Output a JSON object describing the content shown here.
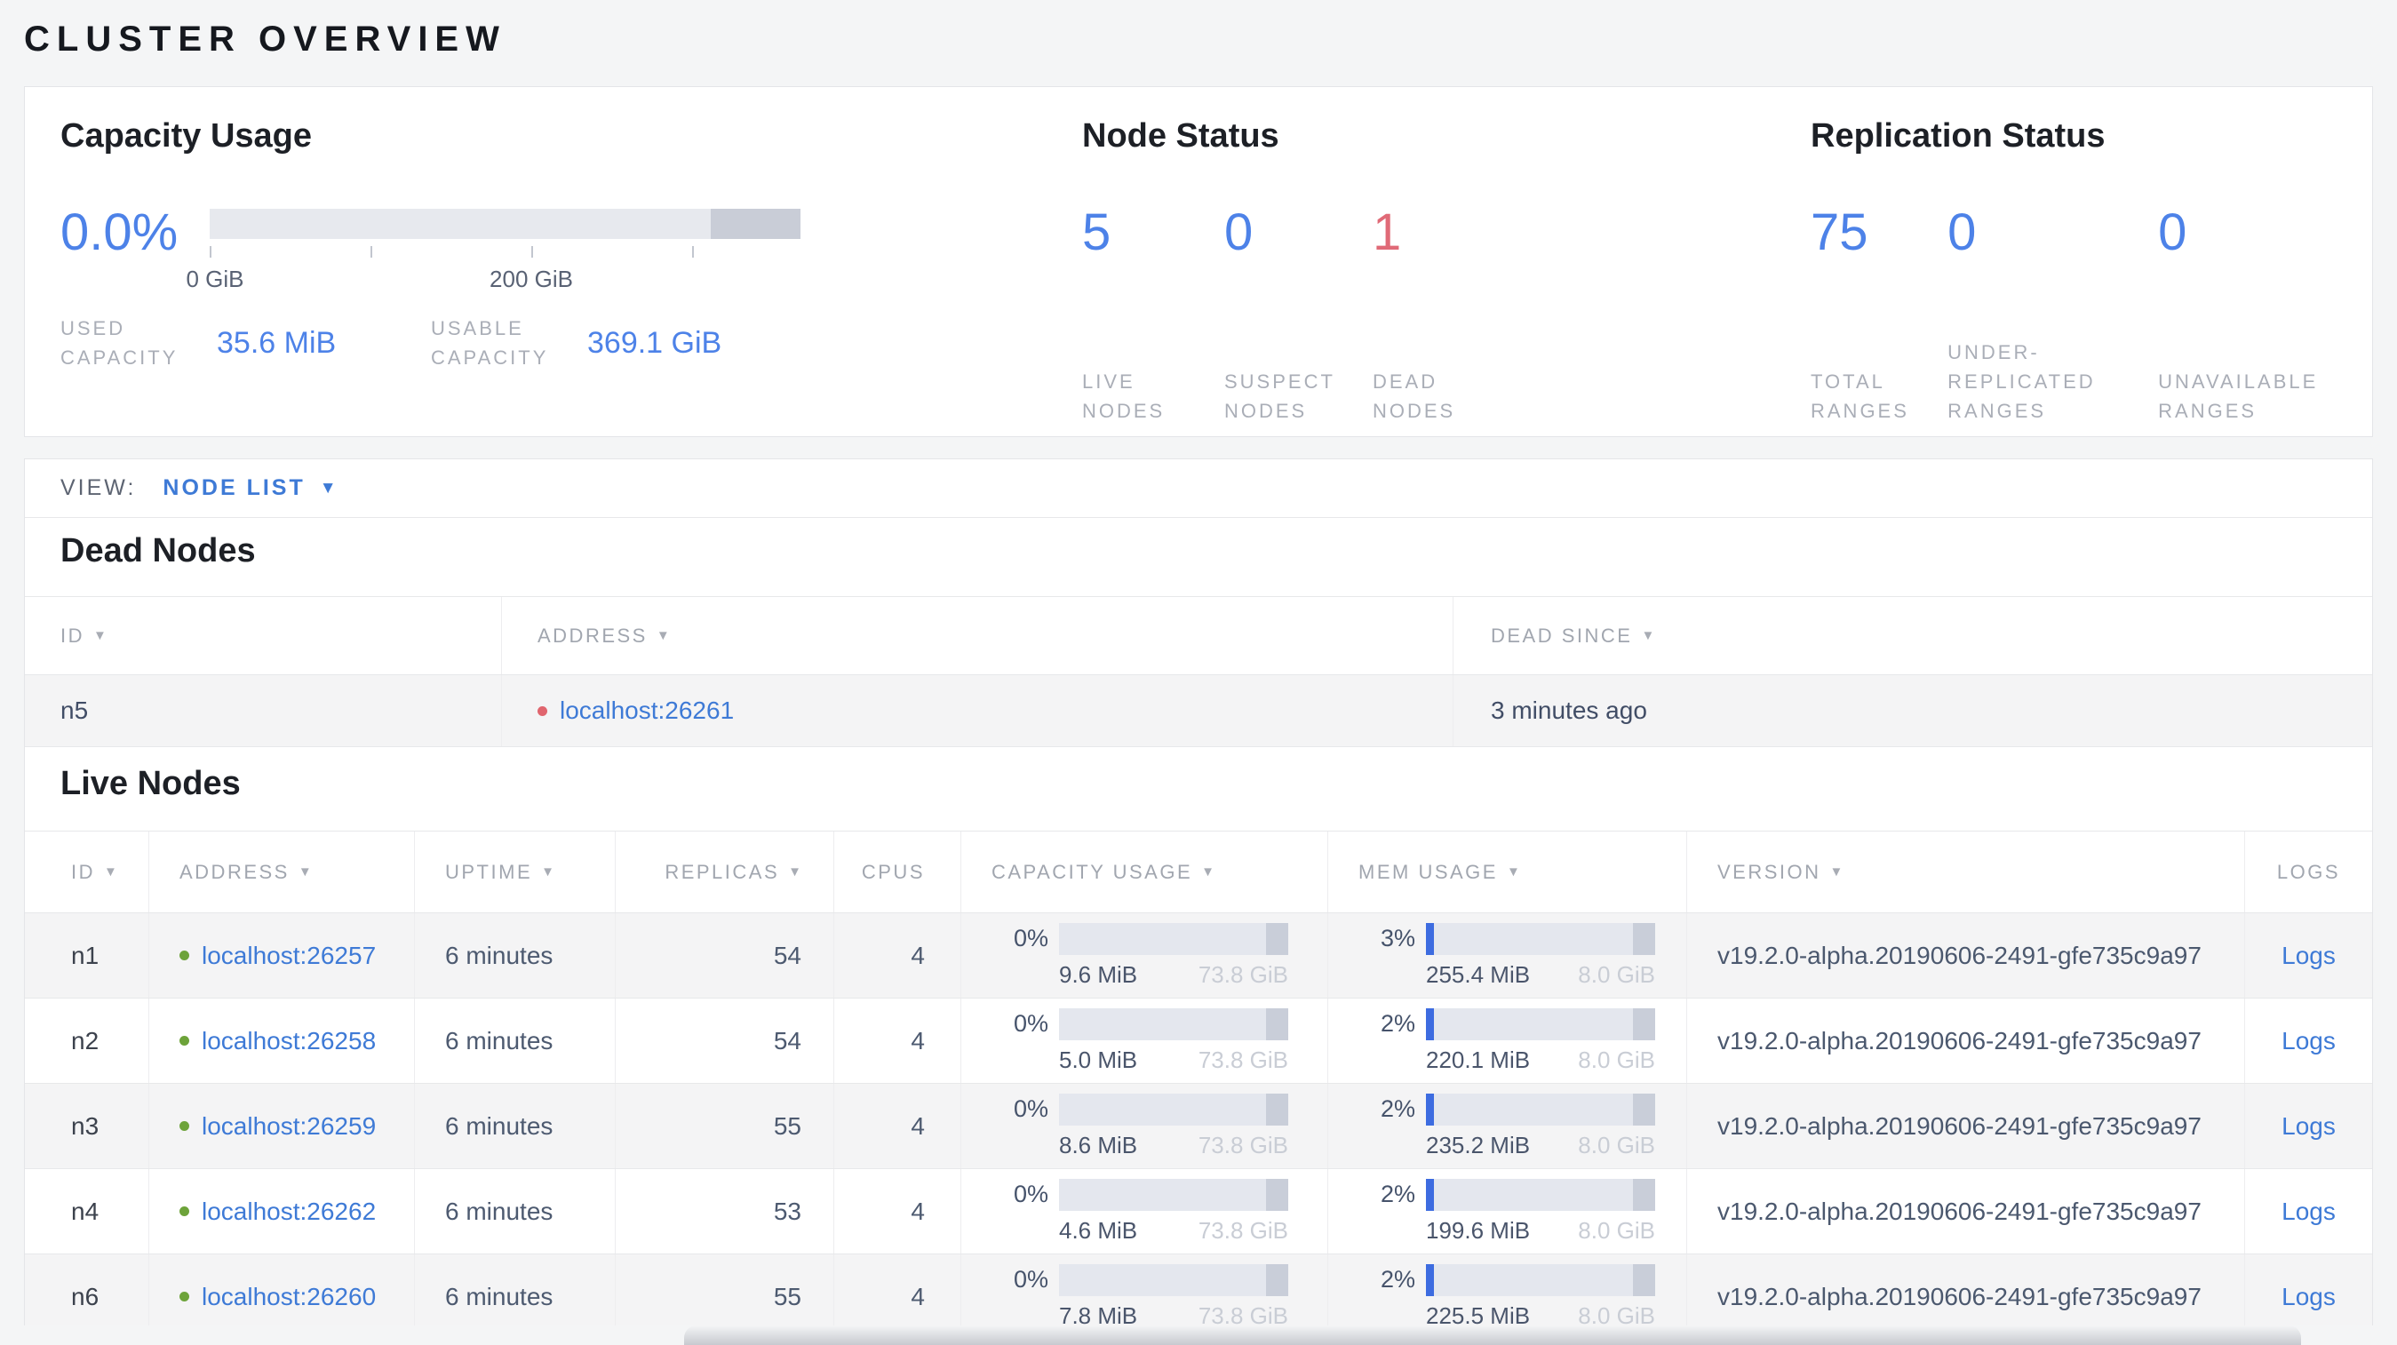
{
  "page_title": "CLUSTER OVERVIEW",
  "ui": {
    "sort_icon": "▼",
    "dropdown_icon": "▼"
  },
  "colors": {
    "accent_blue": "#4d82e8",
    "link_blue": "#3e7ad6",
    "danger_red": "#e06a77",
    "live_green": "#6da33a",
    "dead_dot_red": "#e0656e",
    "mem_fill_blue": "#3d6ce0"
  },
  "summary": {
    "capacity": {
      "title": "Capacity Usage",
      "percent": "0.0%",
      "tick_labels": [
        "0 GiB",
        "200 GiB"
      ],
      "used_label": "USED CAPACITY",
      "used_value": "35.6 MiB",
      "usable_label": "USABLE CAPACITY",
      "usable_value": "369.1 GiB"
    },
    "node_status": {
      "title": "Node Status",
      "stats": [
        {
          "value": "5",
          "label": "LIVE NODES"
        },
        {
          "value": "0",
          "label": "SUSPECT NODES"
        },
        {
          "value": "1",
          "label": "DEAD NODES"
        }
      ]
    },
    "replication": {
      "title": "Replication Status",
      "stats": [
        {
          "value": "75",
          "label": "TOTAL RANGES"
        },
        {
          "value": "0",
          "label": "UNDER-REPLICATED RANGES"
        },
        {
          "value": "0",
          "label": "UNAVAILABLE RANGES"
        }
      ]
    }
  },
  "view_bar": {
    "label": "VIEW:",
    "selected": "NODE LIST"
  },
  "dead_nodes": {
    "heading": "Dead Nodes",
    "columns": [
      {
        "label": "ID"
      },
      {
        "label": "ADDRESS"
      },
      {
        "label": "DEAD SINCE"
      }
    ],
    "rows": [
      {
        "id": "n5",
        "address": "localhost:26261",
        "dead_since": "3 minutes ago"
      }
    ]
  },
  "live_nodes": {
    "heading": "Live Nodes",
    "columns": [
      {
        "label": "ID"
      },
      {
        "label": "ADDRESS"
      },
      {
        "label": "UPTIME"
      },
      {
        "label": "REPLICAS"
      },
      {
        "label": "CPUS"
      },
      {
        "label": "CAPACITY USAGE"
      },
      {
        "label": "MEM USAGE"
      },
      {
        "label": "VERSION"
      },
      {
        "label": "LOGS"
      }
    ],
    "rows": [
      {
        "id": "n1",
        "address": "localhost:26257",
        "uptime": "6 minutes",
        "replicas": "54",
        "cpus": "4",
        "capacity_percent": "0%",
        "capacity_used": "9.6 MiB",
        "capacity_total": "73.8 GiB",
        "mem_percent": "3%",
        "mem_used": "255.4 MiB",
        "mem_total": "8.0 GiB",
        "version": "v19.2.0-alpha.20190606-2491-gfe735c9a97",
        "logs_label": "Logs"
      },
      {
        "id": "n2",
        "address": "localhost:26258",
        "uptime": "6 minutes",
        "replicas": "54",
        "cpus": "4",
        "capacity_percent": "0%",
        "capacity_used": "5.0 MiB",
        "capacity_total": "73.8 GiB",
        "mem_percent": "2%",
        "mem_used": "220.1 MiB",
        "mem_total": "8.0 GiB",
        "version": "v19.2.0-alpha.20190606-2491-gfe735c9a97",
        "logs_label": "Logs"
      },
      {
        "id": "n3",
        "address": "localhost:26259",
        "uptime": "6 minutes",
        "replicas": "55",
        "cpus": "4",
        "capacity_percent": "0%",
        "capacity_used": "8.6 MiB",
        "capacity_total": "73.8 GiB",
        "mem_percent": "2%",
        "mem_used": "235.2 MiB",
        "mem_total": "8.0 GiB",
        "version": "v19.2.0-alpha.20190606-2491-gfe735c9a97",
        "logs_label": "Logs"
      },
      {
        "id": "n4",
        "address": "localhost:26262",
        "uptime": "6 minutes",
        "replicas": "53",
        "cpus": "4",
        "capacity_percent": "0%",
        "capacity_used": "4.6 MiB",
        "capacity_total": "73.8 GiB",
        "mem_percent": "2%",
        "mem_used": "199.6 MiB",
        "mem_total": "8.0 GiB",
        "version": "v19.2.0-alpha.20190606-2491-gfe735c9a97",
        "logs_label": "Logs"
      },
      {
        "id": "n6",
        "address": "localhost:26260",
        "uptime": "6 minutes",
        "replicas": "55",
        "cpus": "4",
        "capacity_percent": "0%",
        "capacity_used": "7.8 MiB",
        "capacity_total": "73.8 GiB",
        "mem_percent": "2%",
        "mem_used": "225.5 MiB",
        "mem_total": "8.0 GiB",
        "version": "v19.2.0-alpha.20190606-2491-gfe735c9a97",
        "logs_label": "Logs"
      }
    ]
  }
}
